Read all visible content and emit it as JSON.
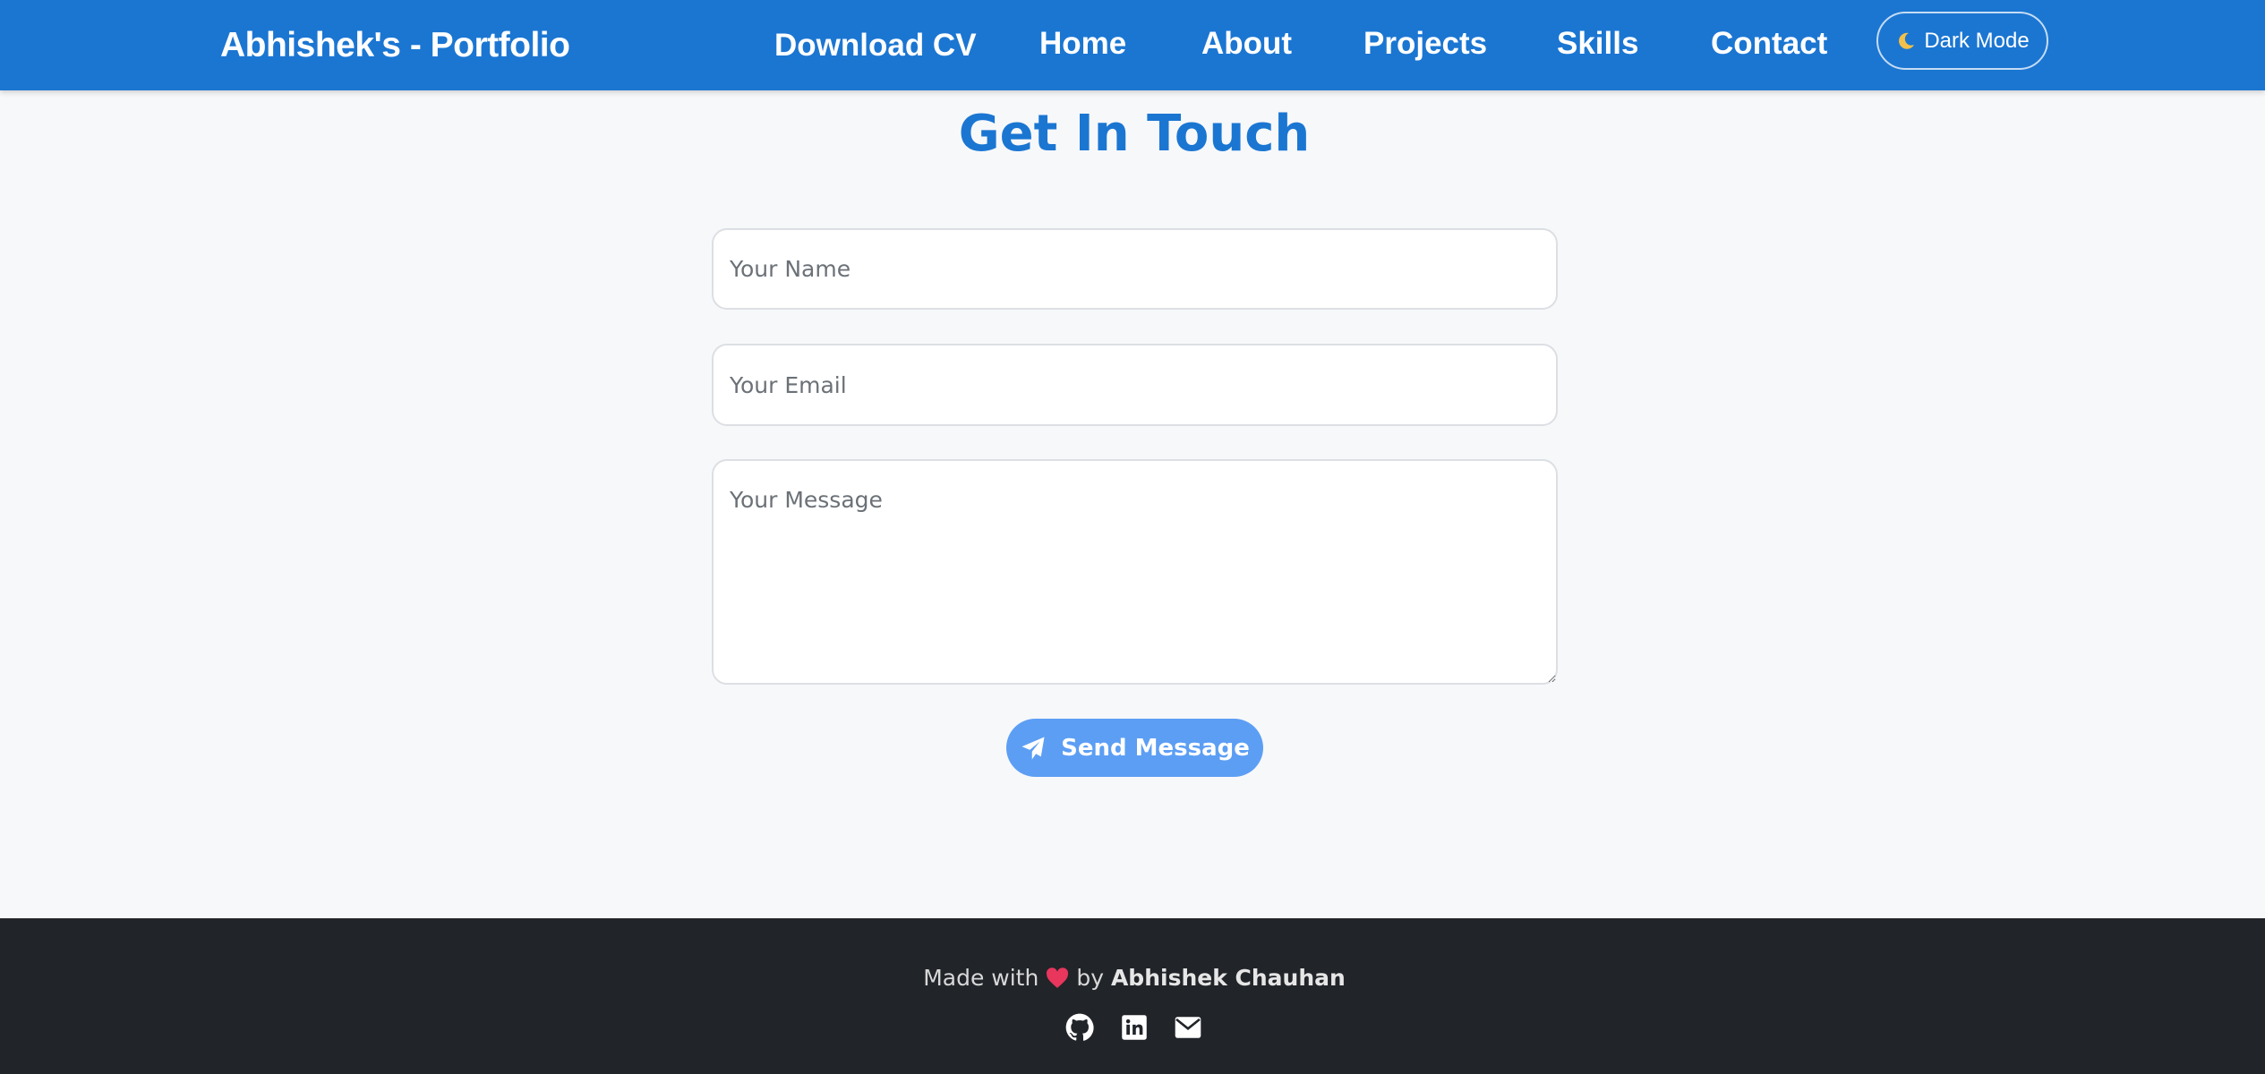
{
  "navbar": {
    "brand": "Abhishek's - Portfolio",
    "links": [
      "Download CV",
      "Home",
      "About",
      "Projects",
      "Skills",
      "Contact"
    ],
    "dark_mode_label": "Dark Mode",
    "dark_mode_icon": "moon-icon",
    "background_color": "#1b76d2"
  },
  "contact": {
    "title": "Get In Touch",
    "name_placeholder": "Your Name",
    "email_placeholder": "Your Email",
    "message_placeholder": "Your Message",
    "send_label": "Send Message",
    "send_icon": "paper-plane-icon",
    "accent_color": "#1b76d2",
    "button_color": "#5c9ef4"
  },
  "footer": {
    "made_with": "Made with",
    "by": "by",
    "author": "Abhishek Chauhan",
    "heart_icon": "heart-icon",
    "social_icons": [
      "github-icon",
      "linkedin-icon",
      "envelope-icon"
    ],
    "background_color": "#212429"
  }
}
